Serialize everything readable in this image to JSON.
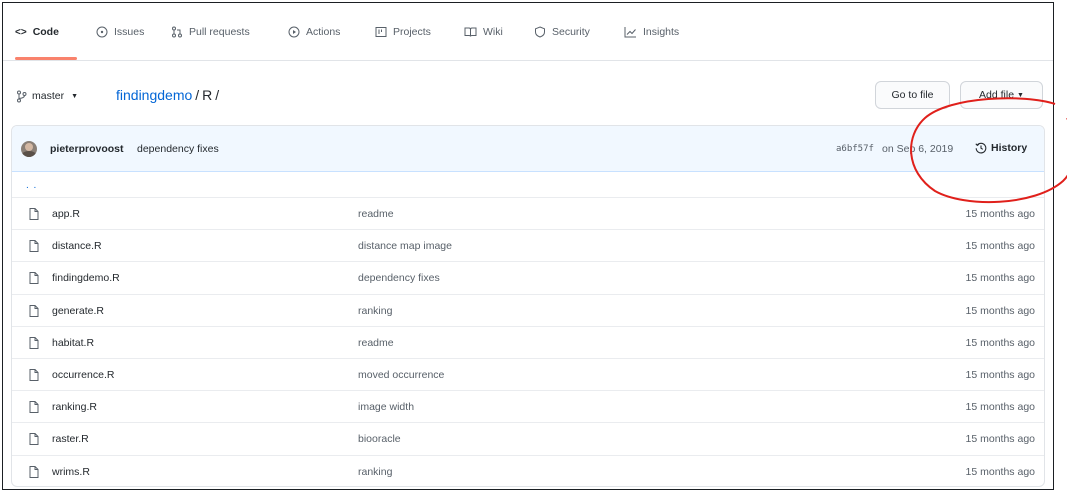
{
  "nav": {
    "tabs": [
      {
        "label": "Code",
        "icon": "code-icon"
      },
      {
        "label": "Issues",
        "icon": "issue-icon"
      },
      {
        "label": "Pull requests",
        "icon": "pull-request-icon"
      },
      {
        "label": "Actions",
        "icon": "play-icon"
      },
      {
        "label": "Projects",
        "icon": "project-icon"
      },
      {
        "label": "Wiki",
        "icon": "book-icon"
      },
      {
        "label": "Security",
        "icon": "shield-icon"
      },
      {
        "label": "Insights",
        "icon": "graph-icon"
      }
    ],
    "active_tab": "Code",
    "accent_color": "#f9826c"
  },
  "toolbar": {
    "branch_label": "master",
    "repo_name": "findingdemo",
    "separator": "/",
    "directory": "R",
    "trailing_separator": "/",
    "goto_file_label": "Go to file",
    "add_file_label": "Add file"
  },
  "commit": {
    "author": "pieterprovoost",
    "message": "dependency fixes",
    "sha": "a6bf57f",
    "date": "on Sep 6, 2019",
    "history_label": "History"
  },
  "parent_dir_label": ". .",
  "files": [
    {
      "name": "app.R",
      "message": "readme",
      "age": "15 months ago"
    },
    {
      "name": "distance.R",
      "message": "distance map image",
      "age": "15 months ago"
    },
    {
      "name": "findingdemo.R",
      "message": "dependency fixes",
      "age": "15 months ago"
    },
    {
      "name": "generate.R",
      "message": "ranking",
      "age": "15 months ago"
    },
    {
      "name": "habitat.R",
      "message": "readme",
      "age": "15 months ago"
    },
    {
      "name": "occurrence.R",
      "message": "moved occurrence",
      "age": "15 months ago"
    },
    {
      "name": "ranking.R",
      "message": "image width",
      "age": "15 months ago"
    },
    {
      "name": "raster.R",
      "message": "biooracle",
      "age": "15 months ago"
    },
    {
      "name": "wrims.R",
      "message": "ranking",
      "age": "15 months ago"
    }
  ],
  "annotation_color": "#e0201b"
}
